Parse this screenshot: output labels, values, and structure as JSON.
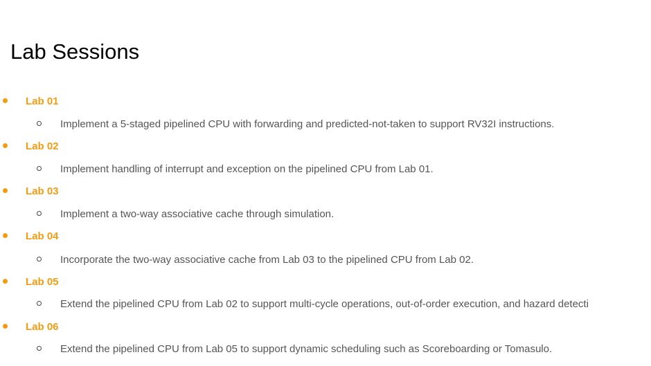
{
  "title": "Lab Sessions",
  "accent_color": "#f39c12",
  "labs": [
    {
      "label": "Lab 01",
      "description": "Implement a 5-staged pipelined CPU with forwarding and predicted-not-taken to support RV32I instructions."
    },
    {
      "label": "Lab 02",
      "description": "Implement handling of interrupt and exception on the pipelined CPU from Lab 01."
    },
    {
      "label": "Lab 03",
      "description": "Implement a two-way associative cache through simulation."
    },
    {
      "label": "Lab 04",
      "description": "Incorporate the two-way associative cache from Lab 03 to the pipelined CPU from Lab 02."
    },
    {
      "label": "Lab 05",
      "description": "Extend the pipelined CPU from Lab 02 to support multi-cycle operations, out-of-order execution, and hazard detecti"
    },
    {
      "label": "Lab 06",
      "description": "Extend the pipelined CPU from Lab 05 to support dynamic scheduling such as Scoreboarding or Tomasulo."
    }
  ]
}
